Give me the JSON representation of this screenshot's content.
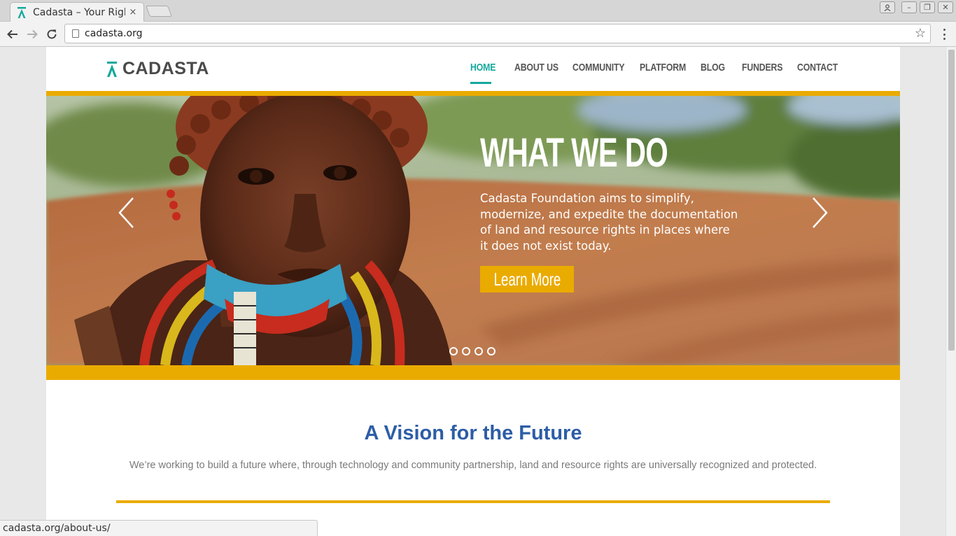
{
  "browser": {
    "tab_title": "Cadasta – Your Righ",
    "close_glyph": "×",
    "url": "cadasta.org",
    "status_url": "cadasta.org/about-us/",
    "window_controls": [
      "–",
      "❐",
      "✕"
    ]
  },
  "site": {
    "logo_text": "CADASTA",
    "brand_color": "#13a89e",
    "accent_color": "#eaab00",
    "title_color": "#2d5da6",
    "nav": [
      {
        "label": "HOME",
        "active": true
      },
      {
        "label": "ABOUT US",
        "active": false
      },
      {
        "label": "COMMUNITY",
        "active": false
      },
      {
        "label": "PLATFORM",
        "active": false
      },
      {
        "label": "BLOG",
        "active": false
      },
      {
        "label": "FUNDERS",
        "active": false
      },
      {
        "label": "CONTACT",
        "active": false
      }
    ]
  },
  "hero": {
    "title": "WHAT WE DO",
    "text": "Cadasta Foundation aims to simplify, modernize, and expedite the documentation of land and resource rights in places where it does not exist today.",
    "button_label": "Learn More",
    "slide_count": 4,
    "prev_icon": "chevron-left-icon",
    "next_icon": "chevron-right-icon"
  },
  "vision": {
    "title": "A Vision for the Future",
    "text": "We’re working to build a future where, through technology and community partnership, land and resource rights are universally recognized and protected."
  }
}
